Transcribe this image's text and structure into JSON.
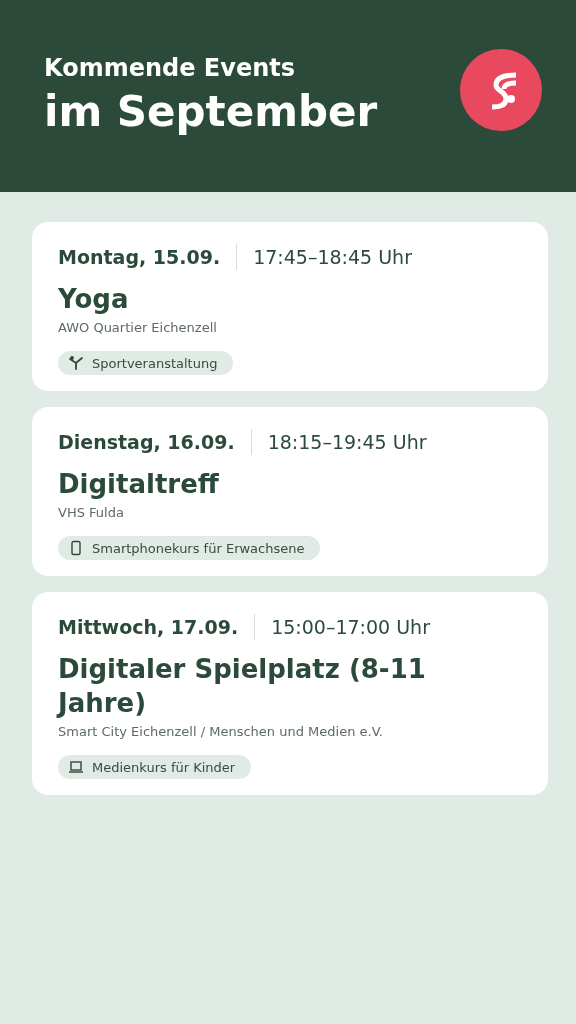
{
  "header": {
    "subtitle": "Kommende Events",
    "title": "im September"
  },
  "events": [
    {
      "date": "Montag, 15.09.",
      "time": "17:45–18:45 Uhr",
      "title": "Yoga",
      "location": "AWO Quartier Eichenzell",
      "tag": {
        "kind": "sport",
        "label": "Sportveranstaltung"
      }
    },
    {
      "date": "Dienstag, 16.09.",
      "time": "18:15–19:45 Uhr",
      "title": "Digitaltreff",
      "location": "VHS Fulda",
      "tag": {
        "kind": "phone",
        "label": "Smartphonekurs für Erwachsene"
      }
    },
    {
      "date": "Mittwoch, 17.09.",
      "time": "15:00–17:00 Uhr",
      "title": "Digitaler Spielplatz (8-11 Jahre)",
      "location": "Smart City Eichenzell / Menschen und Medien e.V.",
      "tag": {
        "kind": "laptop",
        "label": "Medienkurs für Kinder"
      }
    }
  ]
}
